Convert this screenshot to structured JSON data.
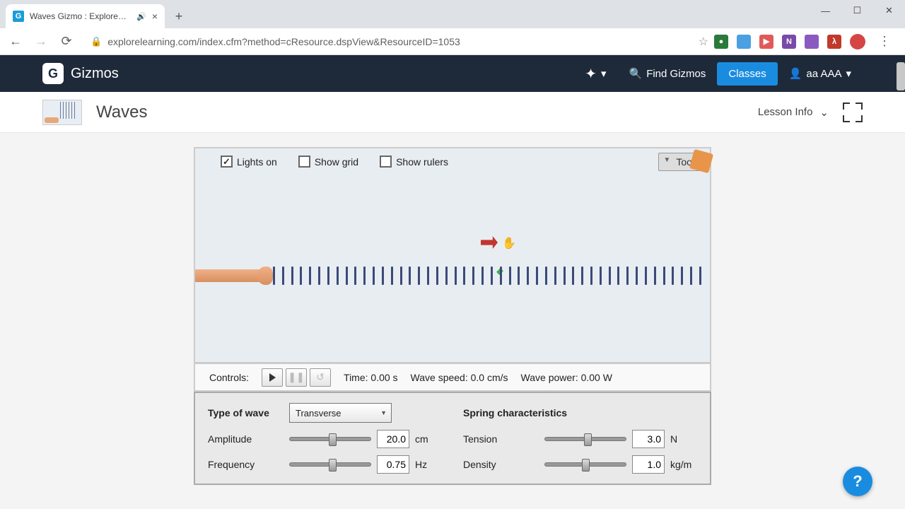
{
  "browser": {
    "tab_title": "Waves Gizmo : ExploreLearni",
    "url": "explorelearning.com/index.cfm?method=cResource.dspView&ResourceID=1053"
  },
  "header": {
    "logo_text": "Gizmos",
    "find_label": "Find Gizmos",
    "classes_label": "Classes",
    "user_name": "aa AAA"
  },
  "page": {
    "title": "Waves",
    "lesson_info": "Lesson Info"
  },
  "sim": {
    "checks": {
      "lights": "Lights on",
      "grid": "Show grid",
      "rulers": "Show rulers"
    },
    "tools": "Tools"
  },
  "controls": {
    "label": "Controls:",
    "time": "Time: 0.00 s",
    "speed": "Wave speed: 0.0 cm/s",
    "power": "Wave power: 0.00 W"
  },
  "params": {
    "type_label": "Type of wave",
    "type_value": "Transverse",
    "spring_head": "Spring characteristics",
    "amplitude": {
      "label": "Amplitude",
      "value": "20.0",
      "unit": "cm",
      "pos": 48
    },
    "frequency": {
      "label": "Frequency",
      "value": "0.75",
      "unit": "Hz",
      "pos": 48
    },
    "tension": {
      "label": "Tension",
      "value": "3.0",
      "unit": "N",
      "pos": 48
    },
    "density": {
      "label": "Density",
      "value": "1.0",
      "unit": "kg/m",
      "pos": 46
    }
  },
  "help": "?"
}
